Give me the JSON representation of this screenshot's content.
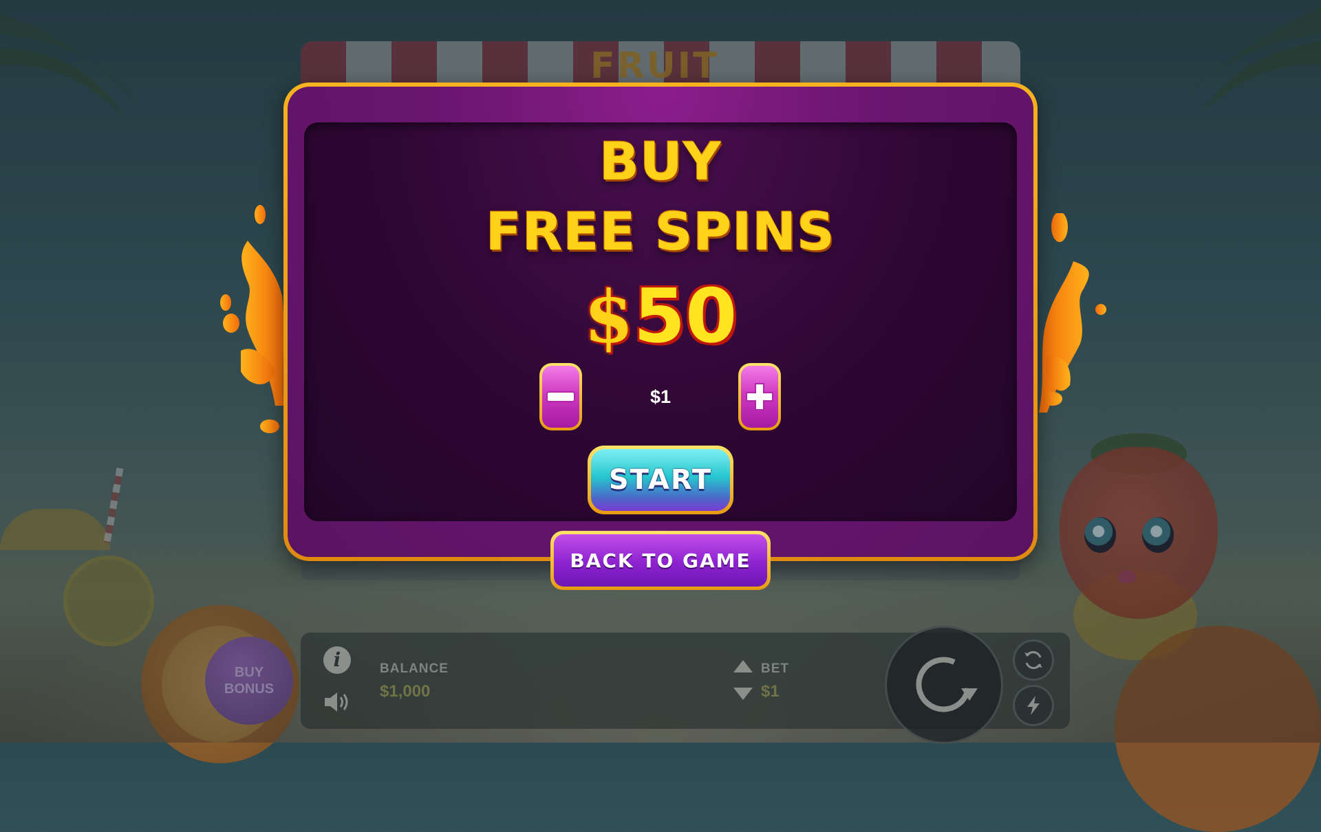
{
  "background": {
    "logo_text": "FRUIT",
    "buy_bonus": {
      "line1": "BUY",
      "line2": "BONUS"
    },
    "balance": {
      "label": "BALANCE",
      "value": "$1,000"
    },
    "bet": {
      "label": "BET",
      "value": "$1"
    },
    "icons": [
      "info-icon",
      "sound-icon",
      "bet-up-icon",
      "bet-down-icon",
      "spin-icon",
      "autoplay-icon",
      "turbo-icon"
    ]
  },
  "modal": {
    "title_line1": "BUY",
    "title_line2": "FREE SPINS",
    "price_currency": "$",
    "price_amount": "50",
    "bet_value": "$1",
    "start_label": "START",
    "back_label": "BACK TO GAME"
  },
  "colors": {
    "title_gold": "#ffd21a",
    "frame_gold": "#f7b21f",
    "modal_purple": "#6b1670",
    "start_teal": "#26c7cf",
    "back_purple": "#8d22d0"
  }
}
